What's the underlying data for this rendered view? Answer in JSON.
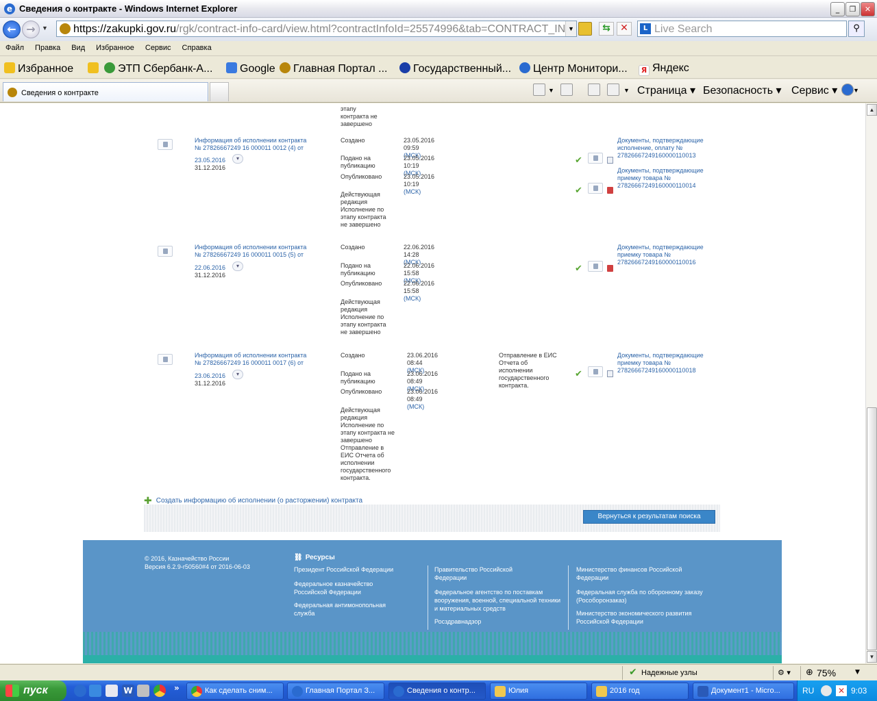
{
  "window": {
    "title": "Сведения о контракте - Windows Internet Explorer",
    "min": "_",
    "max": "❐",
    "close": "✕"
  },
  "address": {
    "url_main": "https://zakupki.gov.ru",
    "url_rest": "/rgk/contract-info-card/view.html?contractInfoId=25574996&tab=CONTRACT_IN",
    "search_placeholder": "Live Search"
  },
  "menu": [
    "Файл",
    "Правка",
    "Вид",
    "Избранное",
    "Сервис",
    "Справка"
  ],
  "favorites": {
    "label": "Избранное",
    "items": [
      "ЭТП Сбербанк-А...",
      "Google",
      "Главная Портал ...",
      "Государственный...",
      "Центр Монитори...",
      "Яндекс"
    ]
  },
  "tab": {
    "label": "Сведения о контракте"
  },
  "commands": {
    "page": "Страница",
    "security": "Безопасность",
    "tools": "Сервис"
  },
  "page": {
    "top_status": [
      "этапу",
      "контракта не",
      "завершено"
    ],
    "rows": [
      {
        "title": [
          "Информация об исполнении контракта",
          "№ 27826667249 16 000011 0012 (4) от"
        ],
        "date": "23.05.2016",
        "end": "31.12.2016",
        "events": [
          {
            "label": "Создано",
            "time": "23.05.2016 09:59",
            "tz": "(МСК)"
          },
          {
            "label": "Подано на публикацию",
            "time": "23.05.2016 10:19",
            "tz": "(МСК)"
          },
          {
            "label": "Опубликовано",
            "time": "23.05.2016 10:19",
            "tz": "(МСК)"
          }
        ],
        "status": "Действующая редакция Исполнение по этапу контракта не завершено",
        "note": "",
        "docs": [
          {
            "text": "Документы, подтверждающие исполнение, оплату № 27826667249160000110013"
          },
          {
            "text": "Документы, подтверждающие приемку товара № 27826667249160000110014"
          }
        ]
      },
      {
        "title": [
          "Информация об исполнении контракта",
          "№ 27826667249 16 000011 0015 (5) от"
        ],
        "date": "22.06.2016",
        "end": "31.12.2016",
        "events": [
          {
            "label": "Создано",
            "time": "22.06.2016 14:28",
            "tz": "(МСК)"
          },
          {
            "label": "Подано на публикацию",
            "time": "22.06.2016 15:58",
            "tz": "(МСК)"
          },
          {
            "label": "Опубликовано",
            "time": "22.06.2016 15:58",
            "tz": "(МСК)"
          }
        ],
        "status": "Действующая редакция Исполнение по этапу контракта не завершено",
        "note": "",
        "docs": [
          {
            "text": "Документы, подтверждающие приемку товара № 27826667249160000110016"
          }
        ]
      },
      {
        "title": [
          "Информация об исполнении контракта",
          "№ 27826667249 16 000011 0017 (6) от"
        ],
        "date": "23.06.2016",
        "end": "31.12.2016",
        "events": [
          {
            "label": "Создано",
            "time": "23.06.2016 08:44",
            "tz": "(МСК)"
          },
          {
            "label": "Подано на публикацию",
            "time": "23.06.2016 08:49",
            "tz": "(МСК)"
          },
          {
            "label": "Опубликовано",
            "time": "23.06.2016 08:49",
            "tz": "(МСК)"
          }
        ],
        "status": "Действующая редакция Исполнение по этапу контракта не завершено Отправление в ЕИС Отчета об исполнении государственного контракта.",
        "note": "Отправление в ЕИС Отчета об исполнении государственного контракта.",
        "docs": [
          {
            "text": "Документы, подтверждающие приемку товара № 27826667249160000110018"
          }
        ]
      }
    ],
    "create_link": "Создать информацию об исполнении (о расторжении) контракта",
    "return_button": "Вернуться к результатам поиска"
  },
  "footer": {
    "copyright": "© 2016, Казначейство России",
    "version": "Версия 6.2.9-r50560#4 от 2016-06-03",
    "resources_head": "Ресурсы",
    "col1": [
      "Президент Российской Федерации",
      "Федеральное казначейство Российской Федерации",
      "Федеральная антимонопольная служба"
    ],
    "col2": [
      "Правительство Российской Федерации",
      "Федеральное агентство по поставкам вооружения, военной, специальной техники и материальных средств",
      "Росздравнадзор"
    ],
    "col3": [
      "Министерство финансов Российской Федерации",
      "Федеральная служба по оборонному заказу (Рособоронзаказ)",
      "Министерство экономического развития Российской Федерации"
    ]
  },
  "status": {
    "zone": "Надежные узлы",
    "zoom": "75%"
  },
  "taskbar": {
    "start": "пуск",
    "buttons": [
      "Как сделать сним...",
      "Главная Портал З...",
      "Сведения о контр...",
      "Юлия",
      "2016 год",
      "Документ1 - Micro..."
    ],
    "lang": "RU",
    "clock": "9:03"
  }
}
